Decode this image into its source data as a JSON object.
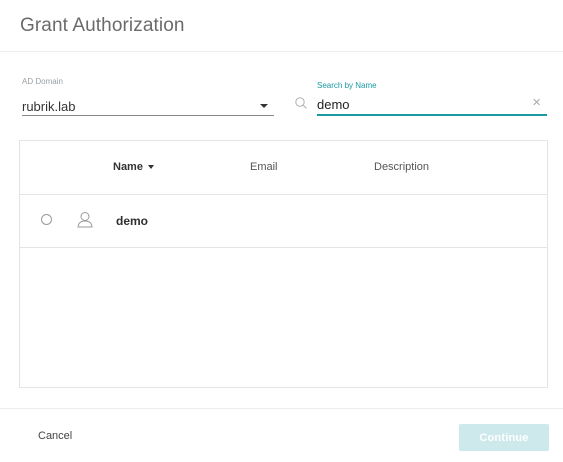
{
  "dialog": {
    "title": "Grant Authorization"
  },
  "ad_domain": {
    "label": "AD Domain",
    "value": "rubrik.lab"
  },
  "search": {
    "label": "Search by Name",
    "value": "demo",
    "placeholder": ""
  },
  "table": {
    "columns": [
      "Name",
      "Email",
      "Description"
    ],
    "sort_column": "Name",
    "sort_direction": "desc",
    "rows": [
      {
        "name": "demo",
        "email": "",
        "description": "",
        "selected": false
      }
    ]
  },
  "footer": {
    "cancel_label": "Cancel",
    "continue_label": "Continue",
    "continue_enabled": false
  },
  "colors": {
    "accent": "#1b9aa2",
    "button_disabled": "#cde9ec"
  },
  "icons": {
    "search": "search-icon",
    "clear": "clear-icon",
    "user": "user-icon",
    "dropdown": "chevron-down-icon"
  }
}
